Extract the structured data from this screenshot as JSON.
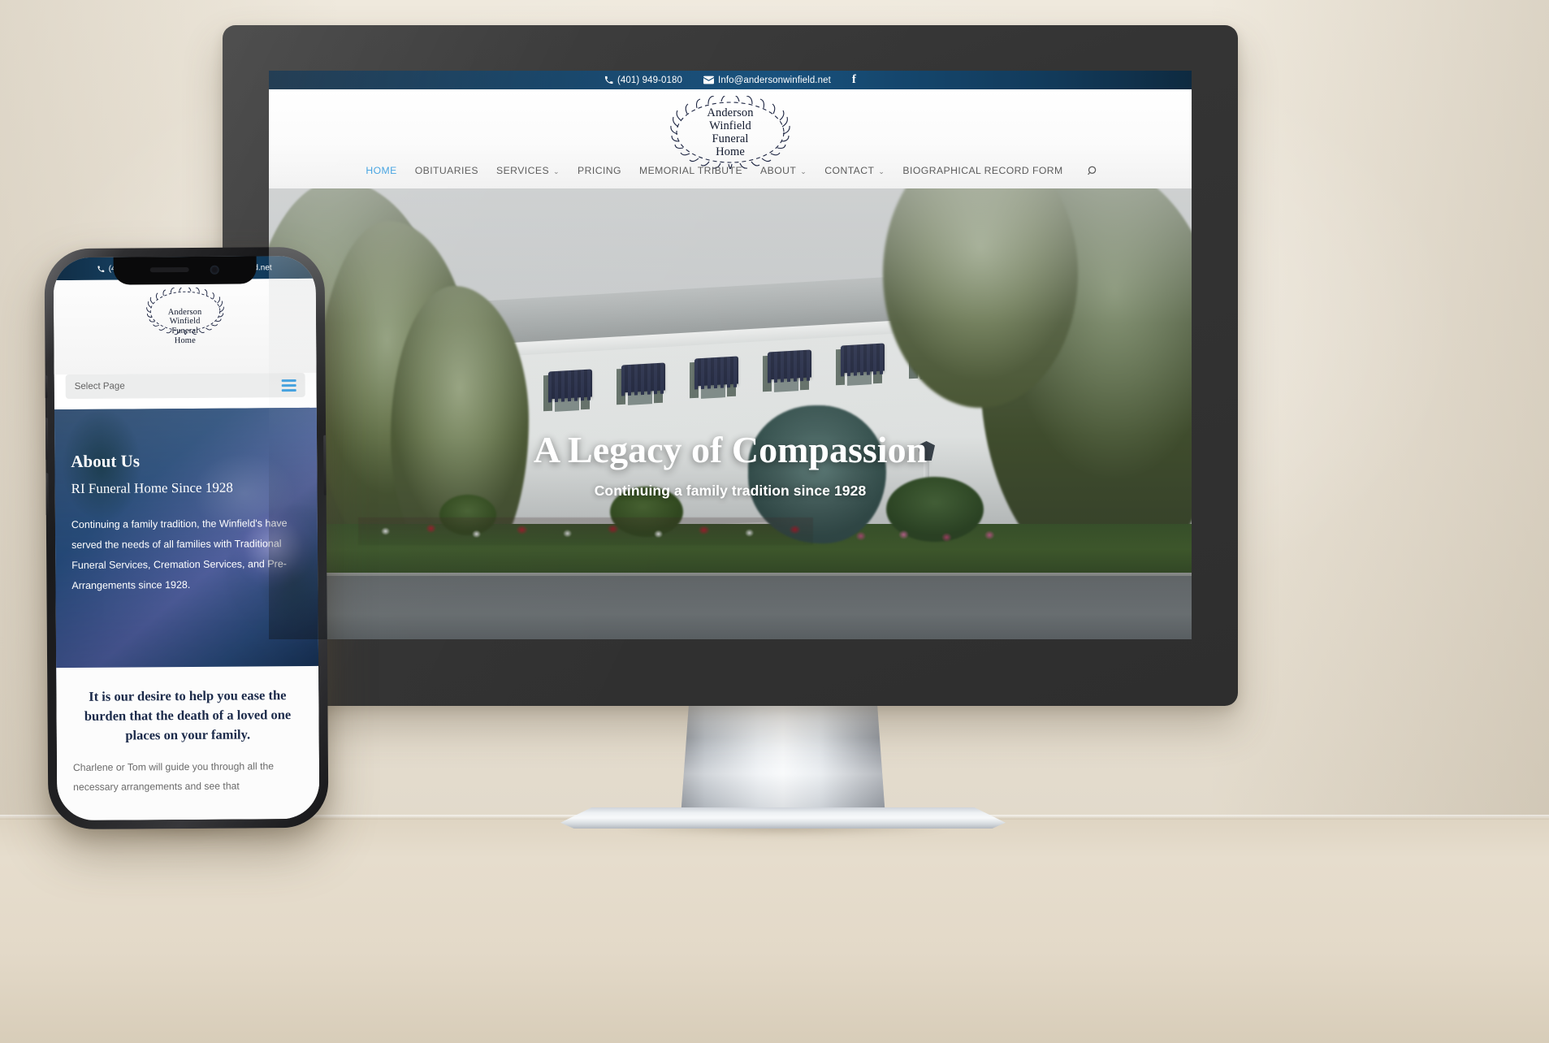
{
  "topbar": {
    "phone": "(401) 949-0180",
    "email": "Info@andersonwinfield.net",
    "phone_icon": "phone-icon",
    "email_icon": "envelope-icon",
    "facebook_icon": "facebook-icon",
    "facebook_glyph": "f",
    "bg_color": "#16486f"
  },
  "logo": {
    "line1": "Anderson",
    "line2": "Winfield",
    "line3": "Funeral",
    "line4": "Home",
    "wreath_icon": "laurel-wreath-icon"
  },
  "nav": {
    "items": [
      {
        "label": "HOME",
        "active": true,
        "has_caret": false
      },
      {
        "label": "OBITUARIES",
        "active": false,
        "has_caret": false
      },
      {
        "label": "SERVICES",
        "active": false,
        "has_caret": true
      },
      {
        "label": "PRICING",
        "active": false,
        "has_caret": false
      },
      {
        "label": "MEMORIAL TRIBUTE",
        "active": false,
        "has_caret": false
      },
      {
        "label": "ABOUT",
        "active": false,
        "has_caret": true
      },
      {
        "label": "CONTACT",
        "active": false,
        "has_caret": true
      },
      {
        "label": "BIOGRAPHICAL RECORD FORM",
        "active": false,
        "has_caret": false
      }
    ],
    "search_icon": "search-icon",
    "caret_glyph": "⌄",
    "active_color": "#3fa0e0",
    "item_color": "#5b5b5b"
  },
  "hero": {
    "title": "A Legacy of Compassion",
    "subtitle": "Continuing a family tradition since 1928",
    "image_alt": "white colonial funeral home with navy awnings and flower beds"
  },
  "phone": {
    "select_page_label": "Select Page",
    "menu_icon": "hamburger-menu-icon",
    "about_heading": "About Us",
    "about_subheading": "RI Funeral Home Since 1928",
    "about_paragraph": "Continuing a family tradition, the Winfield's have served the needs of all families with Traditional Funeral Services, Cremation Services, and Pre-Arrangements since 1928.",
    "quote": "It is our desire to help you ease the burden that the death of a loved one places on your family.",
    "quote_sub": "Charlene or Tom will guide you through all the necessary arrangements and see that"
  },
  "scene": {
    "monitor_color": "#343434",
    "stand_color": "#e9edf1",
    "background_color": "#e8e0d3"
  }
}
